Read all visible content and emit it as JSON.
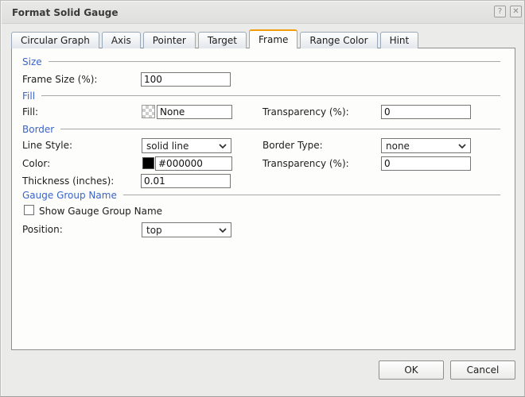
{
  "dialog": {
    "title": "Format Solid Gauge",
    "help_glyph": "?",
    "close_glyph": "✕"
  },
  "tabs": [
    {
      "label": "Circular Graph",
      "active": false
    },
    {
      "label": "Axis",
      "active": false
    },
    {
      "label": "Pointer",
      "active": false
    },
    {
      "label": "Target",
      "active": false
    },
    {
      "label": "Frame",
      "active": true
    },
    {
      "label": "Range Color",
      "active": false
    },
    {
      "label": "Hint",
      "active": false
    }
  ],
  "sections": {
    "size": {
      "header": "Size",
      "frame_size_label": "Frame Size (%):",
      "frame_size_value": "100"
    },
    "fill": {
      "header": "Fill",
      "fill_label": "Fill:",
      "fill_swatch": "none-checkerboard",
      "fill_value": "None",
      "transparency_label": "Transparency (%):",
      "transparency_value": "0"
    },
    "border": {
      "header": "Border",
      "line_style_label": "Line Style:",
      "line_style_value": "solid line",
      "border_type_label": "Border Type:",
      "border_type_value": "none",
      "color_label": "Color:",
      "color_swatch": "#000000",
      "color_value": "#000000",
      "transparency_label": "Transparency (%):",
      "transparency_value": "0",
      "thickness_label": "Thickness (inches):",
      "thickness_value": "0.01"
    },
    "gauge_group_name": {
      "header": "Gauge Group Name",
      "show_label": "Show Gauge Group Name",
      "show_checked": false,
      "position_label": "Position:",
      "position_value": "top"
    }
  },
  "footer": {
    "ok_label": "OK",
    "cancel_label": "Cancel"
  },
  "colors": {
    "accent_orange": "#f09c0c",
    "section_header_blue": "#3a64cb",
    "border_color_swatch": "#000000",
    "panel_bg": "#fdfdfb",
    "dialog_bg": "#ebebe9"
  }
}
